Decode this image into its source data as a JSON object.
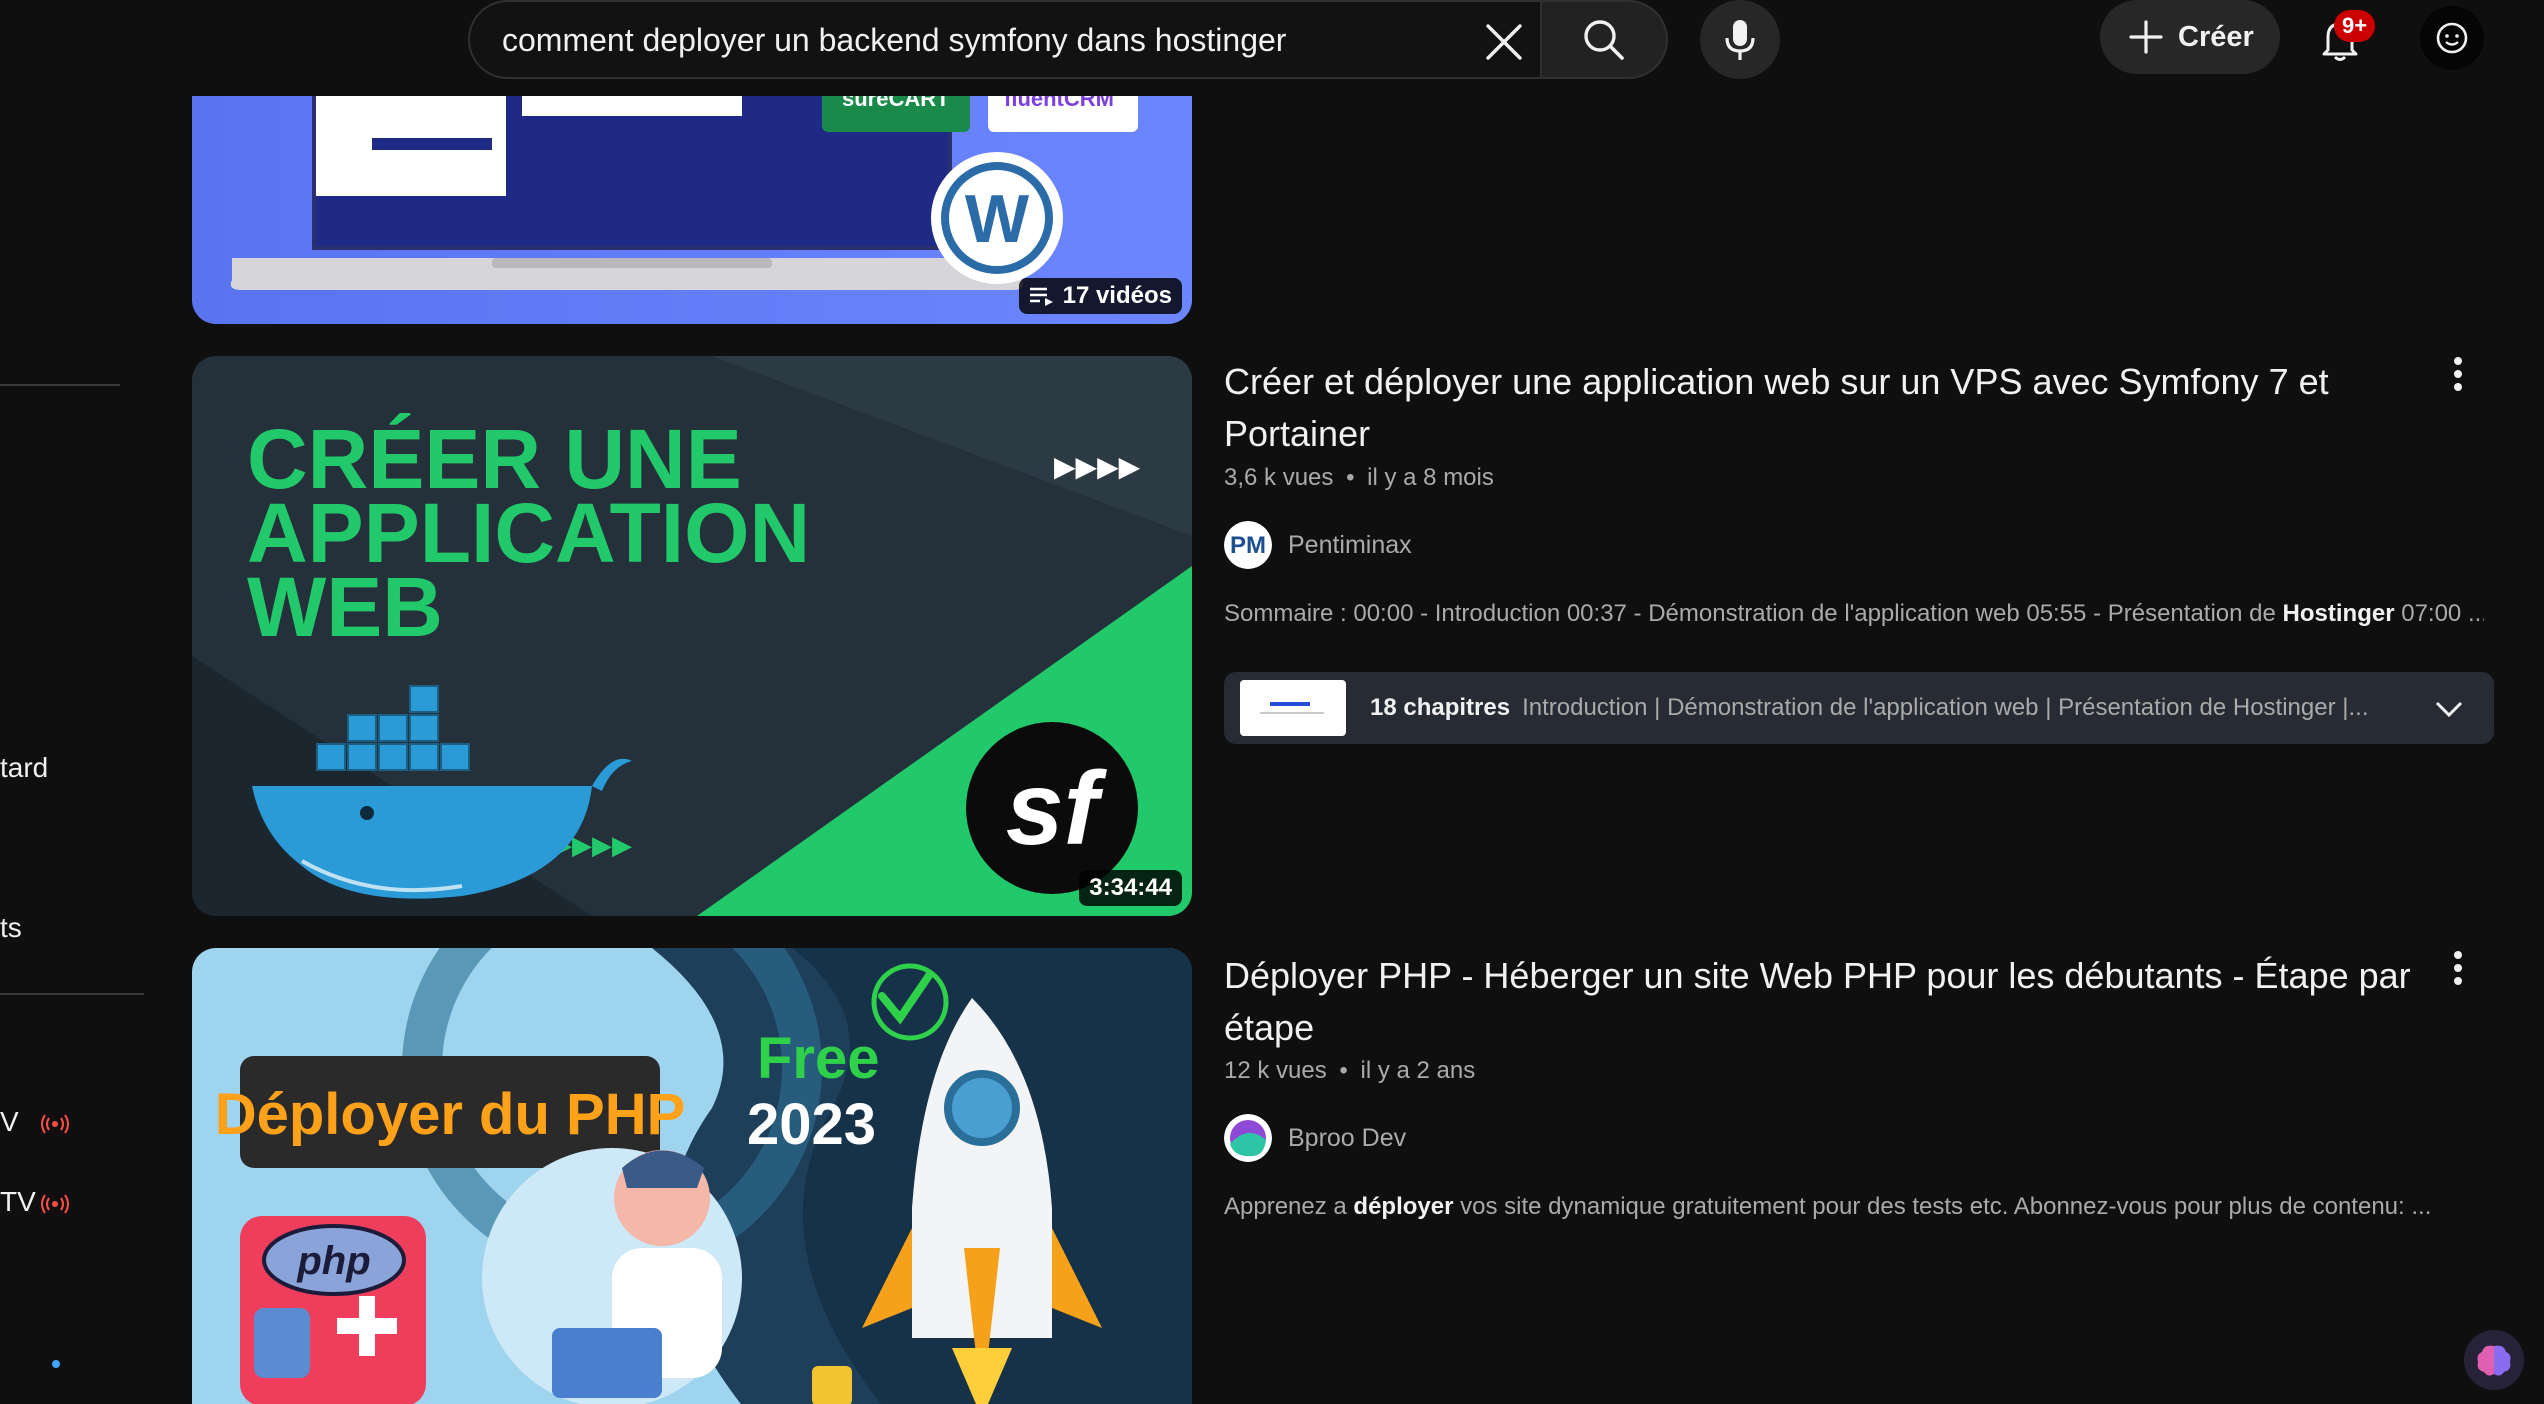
{
  "search": {
    "query": "comment deployer un backend symfony dans hostinger"
  },
  "header": {
    "create_label": "Créer",
    "notification_count": "9+"
  },
  "sidebar": {
    "fragments": [
      {
        "label": "tard"
      },
      {
        "label": "ts"
      },
      {
        "label": "V"
      },
      {
        "label": "TV"
      }
    ]
  },
  "results": [
    {
      "type": "playlist",
      "count_label": "17 vidéos",
      "thumb_texts": {
        "badge_a": "sureCART",
        "badge_b": "fluentCRM"
      }
    },
    {
      "type": "video",
      "title": "Créer et déployer une application web sur un VPS avec Symfony 7 et Portainer",
      "views": "3,6 k vues",
      "age": "il y a 8 mois",
      "channel": "Pentiminax",
      "description_prefix": "Sommaire : 00:00 - Introduction 00:37 - Démonstration de l'application web 05:55 - Présentation de ",
      "description_bold": "Hostinger",
      "description_suffix": " 07:00 ...",
      "duration": "3:34:44",
      "chapters_count": "18 chapitres",
      "chapters_list": "Introduction | Démonstration de l'application web | Présentation de Hostinger |...",
      "thumb_texts": {
        "line1": "CRÉER UNE",
        "line2": "APPLICATION",
        "line3": "WEB",
        "arrows": "▶▶▶▶",
        "logo": "sf",
        "avatar": "PM"
      }
    },
    {
      "type": "video",
      "title": "Déployer PHP - Héberger un site Web PHP pour les débutants - Étape par étape",
      "views": "12 k vues",
      "age": "il y a 2 ans",
      "channel": "Bproo Dev",
      "description_prefix": "Apprenez a ",
      "description_bold": "déployer",
      "description_suffix": " vos site dynamique gratuitement pour des tests etc. Abonnez-vous pour plus de contenu: ...",
      "thumb_texts": {
        "banner": "Déployer du PHP",
        "free": "Free",
        "year": "2023",
        "php": "php"
      }
    }
  ],
  "colors": {
    "background": "#0f0f0f",
    "accent_red": "#cc0000",
    "live_red": "#ff4e45",
    "chapters_bg": "#272b33",
    "thumb2_green": "#22c96b"
  }
}
